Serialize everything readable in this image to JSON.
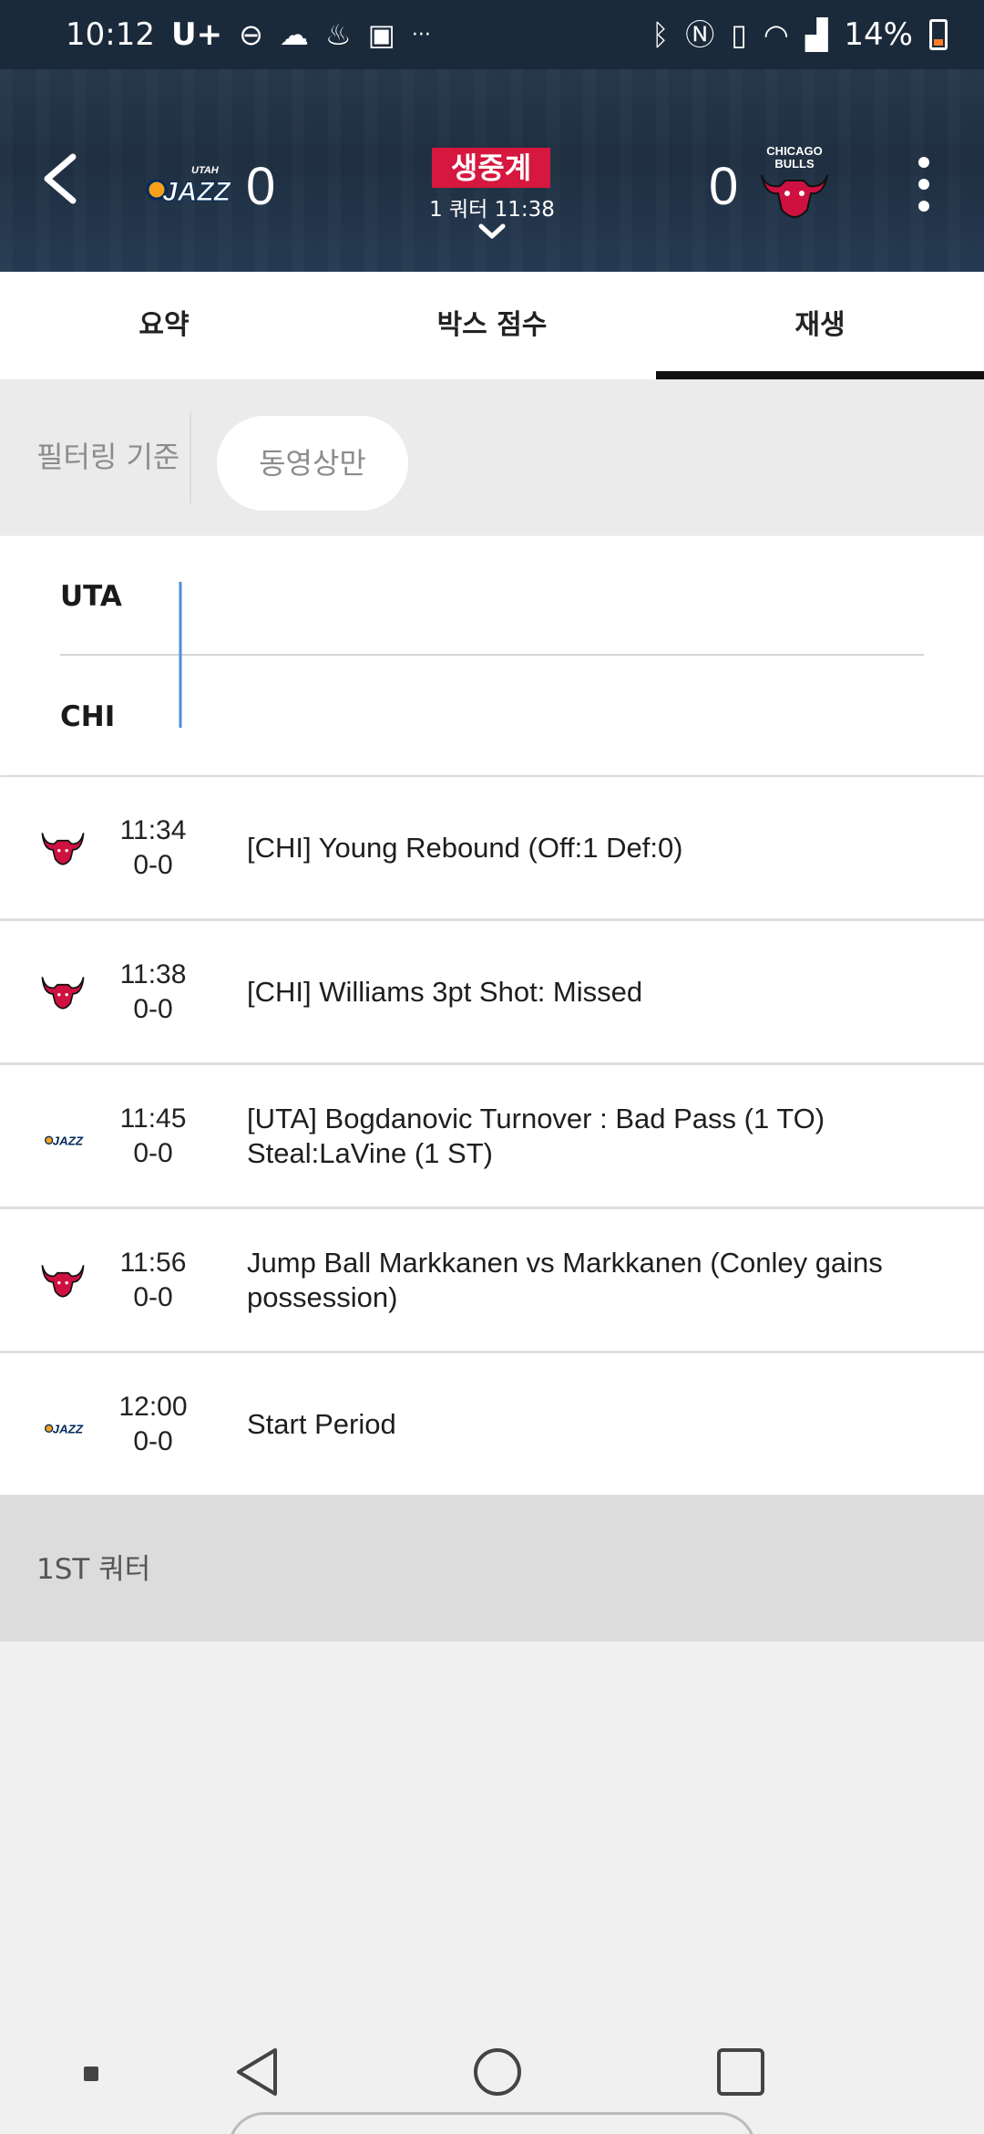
{
  "status_bar": {
    "time": "10:12",
    "carrier": "U+",
    "more": "···",
    "battery": "14%"
  },
  "header": {
    "home_score": "0",
    "away_score": "0",
    "live_label": "생중계",
    "period_time": "1 쿼터 11:38",
    "home_logo_text": "UTAH JAZZ",
    "away_logo_text": "CHICAGO BULLS"
  },
  "tabs": [
    {
      "label": "요약",
      "active": false
    },
    {
      "label": "박스 점수",
      "active": false
    },
    {
      "label": "재생",
      "active": true
    }
  ],
  "filter": {
    "label": "필터링 기준",
    "pill": "동영상만"
  },
  "chart": {
    "teams": [
      "UTA",
      "CHI"
    ]
  },
  "plays": [
    {
      "team": "CHI",
      "time": "11:34",
      "score": "0-0",
      "desc": "[CHI] Young Rebound (Off:1 Def:0)"
    },
    {
      "team": "CHI",
      "time": "11:38",
      "score": "0-0",
      "desc": "[CHI] Williams 3pt Shot: Missed"
    },
    {
      "team": "UTA",
      "time": "11:45",
      "score": "0-0",
      "desc": "[UTA] Bogdanovic Turnover : Bad Pass (1 TO) Steal:LaVine (1 ST)"
    },
    {
      "team": "CHI",
      "time": "11:56",
      "score": "0-0",
      "desc": "Jump Ball Markkanen vs Markkanen (Conley gains possession)"
    },
    {
      "team": "UTA",
      "time": "12:00",
      "score": "0-0",
      "desc": "Start Period"
    }
  ],
  "quarter_label": "1ST 쿼터",
  "colors": {
    "live": "#d6173f",
    "bulls_red": "#ce1141",
    "jazz_navy": "#002b5c",
    "jazz_yellow": "#f9a01b",
    "chart_line": "#4a90d9"
  }
}
